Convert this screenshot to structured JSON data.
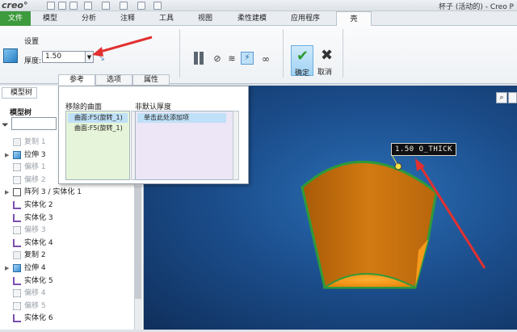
{
  "titlebar": {
    "logo": "creo°",
    "window_title": "杯子 (活动的) - Creo P"
  },
  "ribbon_tabs": {
    "file": "文件",
    "model": "模型",
    "analysis": "分析",
    "annotate": "注释",
    "tools": "工具",
    "view": "视图",
    "flexible": "柔性建模",
    "apps": "应用程序",
    "shell": "壳"
  },
  "ribbon": {
    "settings_label": "设置",
    "thickness_label": "厚度:",
    "thickness_value": "1.50",
    "ok_label": "确定",
    "cancel_label": "取消"
  },
  "subtabs": {
    "references": "参考",
    "options": "选项",
    "properties": "属性"
  },
  "panel": {
    "removed_surfaces_header": "移除的曲面",
    "removed_surfaces": [
      "曲面:F5(旋转_1)",
      "曲面:F5(旋转_1)"
    ],
    "nondefault_thickness_header": "非默认厚度",
    "add_item_hint": "单击此处添加项"
  },
  "model_tree": {
    "tab_label": "模型树",
    "header": "模型树",
    "items": [
      {
        "label": "复制 1",
        "dim": true
      },
      {
        "label": "拉伸 3",
        "dim": false
      },
      {
        "label": "偏移 1",
        "dim": true
      },
      {
        "label": "偏移 2",
        "dim": true
      },
      {
        "label": "阵列 3 / 实体化 1",
        "dim": false
      },
      {
        "label": "实体化 2",
        "dim": false
      },
      {
        "label": "实体化 3",
        "dim": false
      },
      {
        "label": "偏移 3",
        "dim": true
      },
      {
        "label": "实体化 4",
        "dim": false
      },
      {
        "label": "复制 2",
        "dim": false
      },
      {
        "label": "拉伸 4",
        "dim": false
      },
      {
        "label": "实体化 5",
        "dim": false
      },
      {
        "label": "偏移 4",
        "dim": true
      },
      {
        "label": "偏移 5",
        "dim": true
      },
      {
        "label": "实体化 6",
        "dim": false
      }
    ]
  },
  "viewport": {
    "dimension_label": "1.50 O_THICK"
  },
  "colors": {
    "file_tab": "#3d9a3d",
    "shell_outer": "#c2700f",
    "shell_inner": "#f59a1b",
    "shell_edge": "#2f9a3a",
    "annotation_arrow": "#e23030"
  },
  "icons": [
    "shell-icon",
    "flip-icon",
    "pause-icon",
    "no-icon",
    "verify-icon",
    "preview-icon",
    "glasses-icon",
    "ok-check-icon",
    "cancel-x-icon",
    "filter-icon",
    "zoom-icon"
  ]
}
